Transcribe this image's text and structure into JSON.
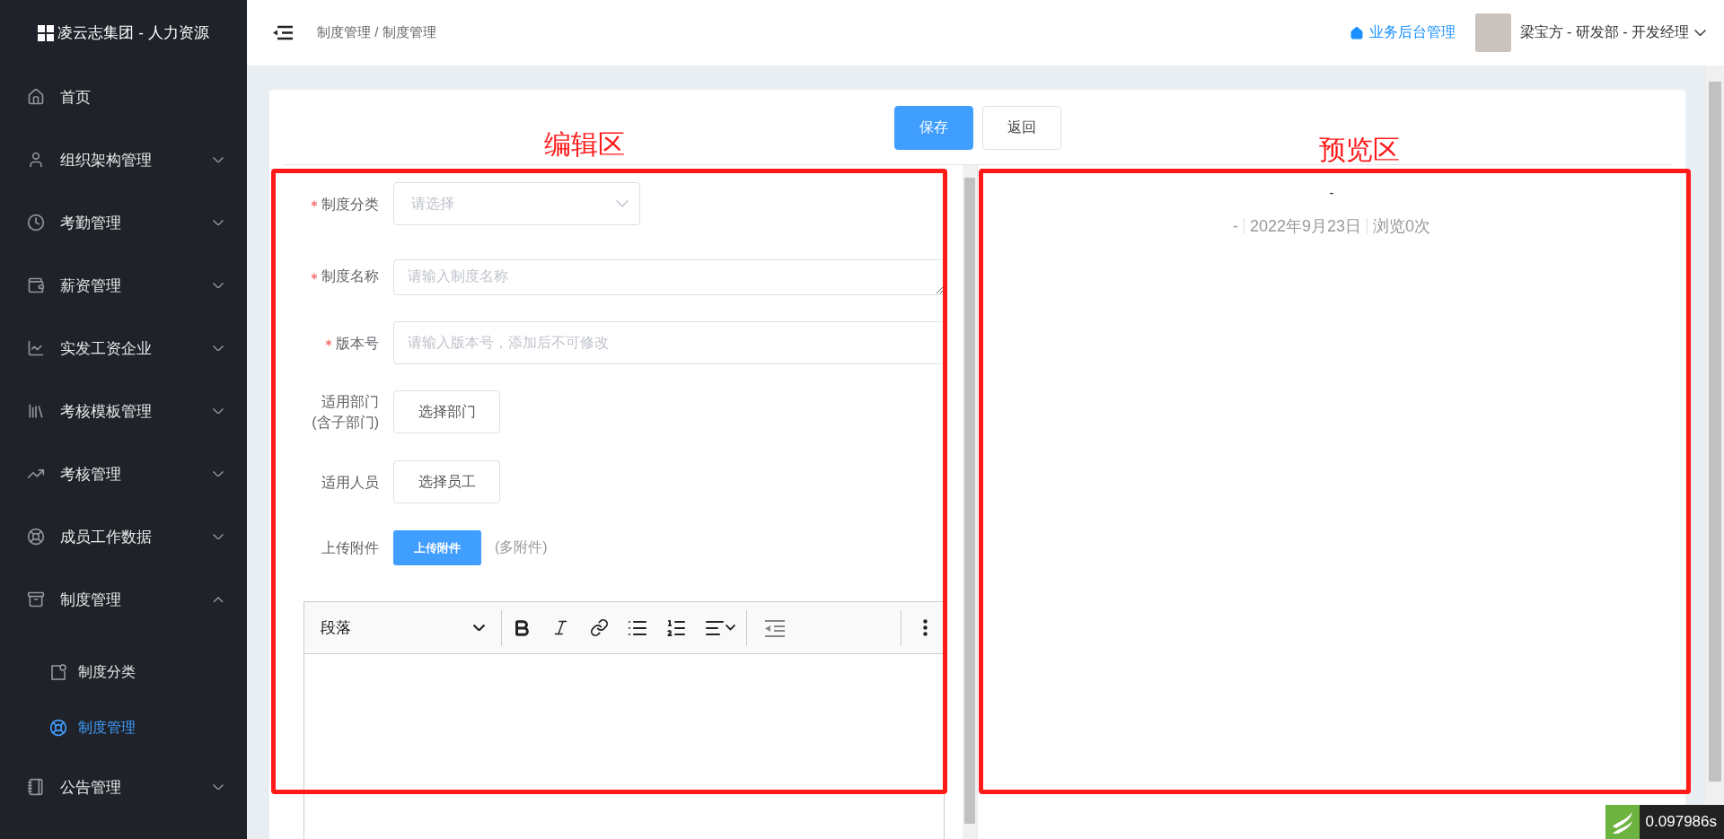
{
  "sidebar": {
    "logo": "凌云志集团 - 人力资源",
    "items": [
      {
        "label": "首页",
        "selected": false
      },
      {
        "label": "组织架构管理",
        "selected": false,
        "expanded": false
      },
      {
        "label": "考勤管理",
        "selected": false,
        "expanded": false
      },
      {
        "label": "薪资管理",
        "selected": false,
        "expanded": false
      },
      {
        "label": "实发工资企业",
        "selected": false,
        "expanded": false
      },
      {
        "label": "考核模板管理",
        "selected": false,
        "expanded": false
      },
      {
        "label": "考核管理",
        "selected": false,
        "expanded": false
      },
      {
        "label": "成员工作数据",
        "selected": false,
        "expanded": false
      },
      {
        "label": "制度管理",
        "selected": false,
        "expanded": true,
        "children": [
          {
            "label": "制度分类",
            "selected": false
          },
          {
            "label": "制度管理",
            "selected": true
          }
        ]
      },
      {
        "label": "公告管理",
        "selected": false,
        "expanded": false
      }
    ]
  },
  "header": {
    "breadcrumb": "制度管理 / 制度管理",
    "admin_link": "业务后台管理",
    "user": "梁宝方 - 研发部 - 开发经理"
  },
  "actions": [
    {
      "label": "保存",
      "kind": "primary"
    },
    {
      "label": "返回",
      "kind": "default"
    }
  ],
  "annotations": [
    {
      "text": "编辑区"
    },
    {
      "text": "预览区"
    }
  ],
  "form": {
    "fields": [
      {
        "kind": "select",
        "label": "制度分类",
        "required": true,
        "placeholder": "请选择"
      },
      {
        "kind": "textarea",
        "label": "制度名称",
        "required": true,
        "placeholder": "请输入制度名称"
      },
      {
        "kind": "input",
        "label": "版本号",
        "required": true,
        "placeholder": "请输入版本号，添加后不可修改"
      },
      {
        "kind": "picker",
        "label": "适用部门",
        "sublabel": "(含子部门)",
        "required": false,
        "button": "选择部门"
      },
      {
        "kind": "picker",
        "label": "适用人员",
        "required": false,
        "button": "选择员工"
      },
      {
        "kind": "upload",
        "label": "上传附件",
        "required": false,
        "button": "上传附件",
        "hint": "(多附件)"
      }
    ],
    "editor": {
      "block_format": "段落"
    }
  },
  "preview": {
    "title": "-",
    "meta": [
      "-",
      "2022年9月23日",
      "浏览0次"
    ]
  },
  "perf_badge": {
    "time": "0.097986s"
  }
}
